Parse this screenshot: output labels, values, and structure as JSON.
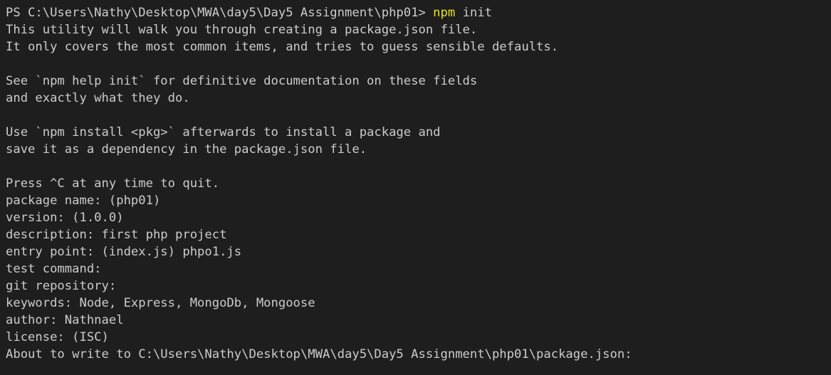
{
  "terminal": {
    "prompt": "PS C:\\Users\\Nathy\\Desktop\\MWA\\day5\\Day5 Assignment\\php01> ",
    "command_exe": "npm",
    "command_args": " init",
    "lines": [
      "This utility will walk you through creating a package.json file.",
      "It only covers the most common items, and tries to guess sensible defaults.",
      "",
      "See `npm help init` for definitive documentation on these fields",
      "and exactly what they do.",
      "",
      "Use `npm install <pkg>` afterwards to install a package and",
      "save it as a dependency in the package.json file.",
      "",
      "Press ^C at any time to quit.",
      "package name: (php01)",
      "version: (1.0.0)",
      "description: first php project",
      "entry point: (index.js) phpo1.js",
      "test command:",
      "git repository:",
      "keywords: Node, Express, MongoDb, Mongoose",
      "author: Nathnael",
      "license: (ISC)",
      "About to write to C:\\Users\\Nathy\\Desktop\\MWA\\day5\\Day5 Assignment\\php01\\package.json:"
    ]
  },
  "colors": {
    "background": "#1e1e1e",
    "text": "#cccccc",
    "command_highlight": "#e5e510"
  }
}
